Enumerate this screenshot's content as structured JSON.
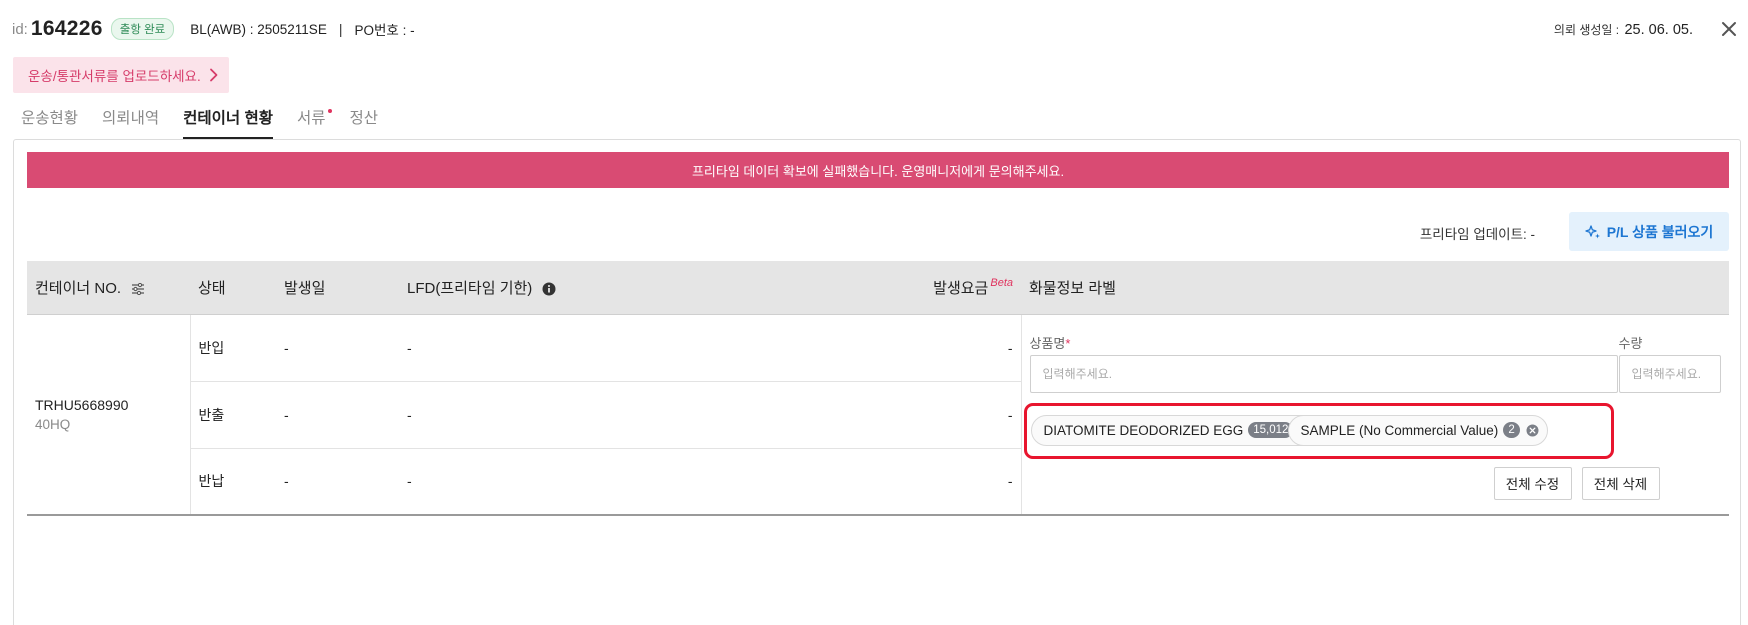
{
  "header": {
    "id_prefix": "id:",
    "id_value": "164226",
    "status": "출항 완료",
    "bl": "BL(AWB) : 2505211SE",
    "separator": "|",
    "po": "PO번호 : -",
    "created_label": "의뢰 생성일 :",
    "created_value": "25. 06. 05."
  },
  "upload_banner": {
    "text": "운송/통관서류를 업로드하세요."
  },
  "tabs": [
    {
      "label": "운송현황"
    },
    {
      "label": "의뢰내역"
    },
    {
      "label": "컨테이너 현황",
      "active": true
    },
    {
      "label": "서류",
      "has_dot": true
    },
    {
      "label": "정산"
    }
  ],
  "error_banner": "프리타임 데이터 확보에 실패했습니다. 운영매니저에게 문의해주세요.",
  "freetime_update": "프리타임 업데이트: -",
  "pl_button": "P/L 상품 불러오기",
  "table": {
    "headers": {
      "container": "컨테이너 NO.",
      "status": "상태",
      "date": "발생일",
      "lfd": "LFD(프리타임 기한)",
      "fee": "발생요금",
      "beta": "Beta",
      "label": "화물정보 라벨"
    },
    "container": {
      "number": "TRHU5668990",
      "type": "40HQ"
    },
    "rows": [
      {
        "status": "반입",
        "date": "-",
        "lfd": "-",
        "fee": "-"
      },
      {
        "status": "반출",
        "date": "-",
        "lfd": "-",
        "fee": "-"
      },
      {
        "status": "반납",
        "date": "-",
        "lfd": "-",
        "fee": "-"
      }
    ]
  },
  "cargo_label": {
    "name_label": "상품명",
    "required_mark": "*",
    "qty_label": "수량",
    "name_placeholder": "입력해주세요.",
    "qty_placeholder": "입력해주세요.",
    "chips": [
      {
        "label": "DIATOMITE DEODORIZED EGG",
        "count": "15,012"
      },
      {
        "label": "SAMPLE (No Commercial Value)",
        "count": "2"
      }
    ],
    "edit_all": "전체 수정",
    "delete_all": "전체 삭제"
  },
  "colors": {
    "accent_pink": "#d94b73",
    "banner_pink_bg": "#fbe3ea",
    "primary_blue": "#1d76d2",
    "highlight_red": "#e8152e",
    "status_green": "#2e8b57"
  }
}
